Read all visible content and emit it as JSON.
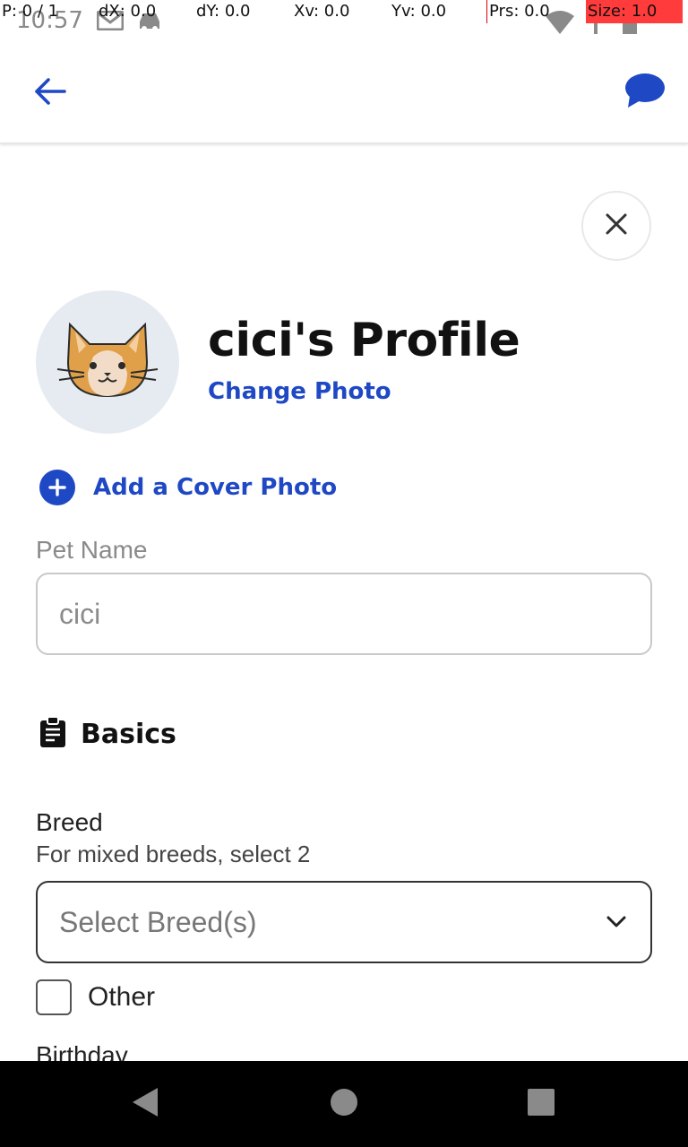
{
  "status_bar": {
    "time": "10:57",
    "icons": [
      "gmail-icon",
      "car-icon",
      "wifi-icon",
      "signal-icon",
      "battery-icon"
    ]
  },
  "debug_overlay": {
    "pointer": "P: 0 / 1",
    "dx": "dX: 0.0",
    "dy": "dY: 0.0",
    "xv": "Xv: 0.0",
    "yv": "Yv: 0.0",
    "prs": "Prs: 0.0",
    "size": "Size: 1.0"
  },
  "app_bar": {
    "back_icon": "arrow-left-icon",
    "chat_icon": "chat-bubble-icon"
  },
  "profile": {
    "title": "cici's Profile",
    "change_photo_label": "Change Photo",
    "avatar_icon": "cat-face-icon"
  },
  "cover_photo": {
    "label": "Add a Cover Photo"
  },
  "pet_name": {
    "label": "Pet Name",
    "value": "cici"
  },
  "basics": {
    "label": "Basics",
    "icon": "clipboard-icon"
  },
  "breed": {
    "label": "Breed",
    "help": "For mixed breeds, select 2",
    "placeholder": "Select Breed(s)"
  },
  "other_checkbox": {
    "label": "Other",
    "checked": false
  },
  "birthday": {
    "label": "Birthday"
  },
  "colors": {
    "accent": "#1f48c4",
    "avatar_bg": "#e6ebf1",
    "debug_red": "#ff3b3b"
  }
}
